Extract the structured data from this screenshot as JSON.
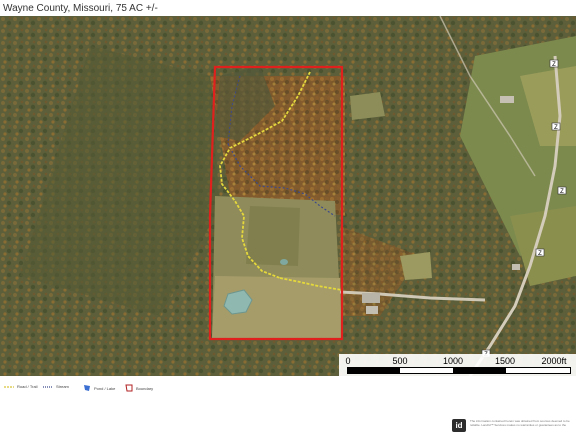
{
  "header": {
    "title": "Wayne County, Missouri, 75 AC +/-"
  },
  "map": {
    "boundary_color": "#e0201c",
    "trail_color": "#e4d83c",
    "stream_color": "#3c4a8c",
    "pond_color": "#8fb9b0",
    "forest_color": "#5a5f38",
    "road_color": "#c9bfae",
    "route_markers": [
      "Z",
      "Z",
      "Z",
      "Z",
      "Z"
    ]
  },
  "scale_bar": {
    "ticks": [
      "0",
      "500",
      "1000",
      "1500",
      "2000ft"
    ]
  },
  "legend": {
    "items": [
      {
        "label": "Road / Trail",
        "icon": "dotted-line-yellow",
        "color": "#d8c43a"
      },
      {
        "label": "Stream",
        "icon": "dotted-line-blue",
        "color": "#3c4a8c"
      },
      {
        "label": "Pond / Lake",
        "icon": "pond-swatch",
        "color": "#3b6fd1"
      },
      {
        "label": "Boundary",
        "icon": "boundary-swatch",
        "color": "#b02020"
      }
    ]
  },
  "footer": {
    "logo_text": "id",
    "disclaimer": "The information contained herein was obtained from sources deemed to be reliable. LandId™ Services makes no warranties or guarantees as to the"
  }
}
